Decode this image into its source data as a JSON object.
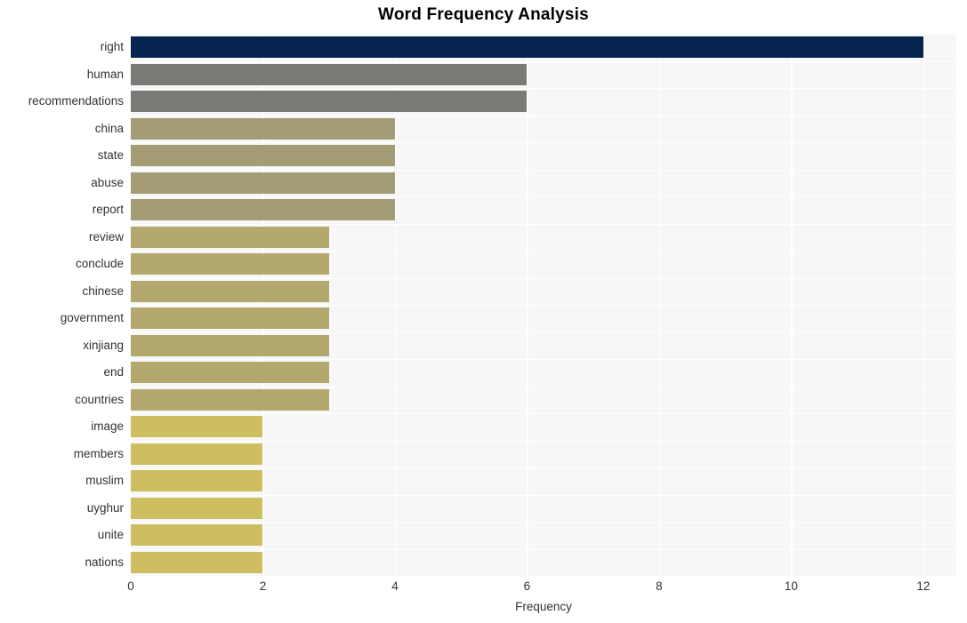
{
  "chart_data": {
    "type": "bar",
    "orientation": "horizontal",
    "title": "Word Frequency Analysis",
    "xlabel": "Frequency",
    "ylabel": "",
    "categories": [
      "right",
      "human",
      "recommendations",
      "china",
      "state",
      "abuse",
      "report",
      "review",
      "conclude",
      "chinese",
      "government",
      "xinjiang",
      "end",
      "countries",
      "image",
      "members",
      "muslim",
      "uyghur",
      "unite",
      "nations"
    ],
    "values": [
      12,
      6,
      6,
      4,
      4,
      4,
      4,
      3,
      3,
      3,
      3,
      3,
      3,
      3,
      2,
      2,
      2,
      2,
      2,
      2
    ],
    "bar_colors": [
      "#07244f",
      "#7b7a77",
      "#7b7a77",
      "#a49c75",
      "#a49c75",
      "#a49c75",
      "#a49c75",
      "#b3a96e",
      "#b3a96e",
      "#b3a96e",
      "#b3a96e",
      "#b3a96e",
      "#b3a96e",
      "#b3a96e",
      "#cdbf5f",
      "#cdbf5f",
      "#cdbf5f",
      "#cdbf5f",
      "#cdbf5f",
      "#cdbf5f"
    ],
    "xticks": [
      0,
      2,
      4,
      6,
      8,
      10,
      12
    ],
    "xtick_labels": [
      "0",
      "2",
      "4",
      "6",
      "8",
      "10",
      "12"
    ],
    "xlim": [
      0,
      12.5
    ],
    "grid": true,
    "grid_color": "#ffffff",
    "plot_background": "#f7f7f7",
    "figure_background": "#ffffff",
    "legend": null
  }
}
